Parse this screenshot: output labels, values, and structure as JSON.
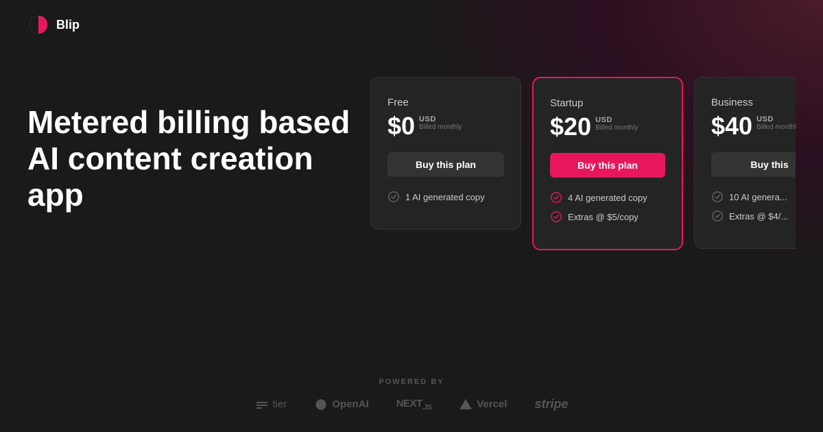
{
  "brand": {
    "logo_text": "Blip"
  },
  "hero": {
    "title_line1": "Metered billing based",
    "title_line2": "AI content creation app"
  },
  "pricing": {
    "plans": [
      {
        "id": "free",
        "name": "Free",
        "price": "$0",
        "currency": "USD",
        "billing": "Billed monthly",
        "button_label": "Buy this plan",
        "featured": false,
        "features": [
          "1 AI generated copy"
        ]
      },
      {
        "id": "startup",
        "name": "Startup",
        "price": "$20",
        "currency": "USD",
        "billing": "Billed monthly",
        "button_label": "Buy this plan",
        "featured": true,
        "features": [
          "4 AI generated copy",
          "Extras @ $5/copy"
        ]
      },
      {
        "id": "business",
        "name": "Business",
        "price": "$40",
        "currency": "USD",
        "billing": "Billed monthly",
        "button_label": "Buy this",
        "featured": false,
        "features": [
          "10 AI genera...",
          "Extras @ $4/..."
        ]
      }
    ]
  },
  "footer": {
    "powered_by_label": "POWERED BY",
    "partners": [
      "tier",
      "OpenAI",
      "NEXT.js",
      "Vercel",
      "stripe"
    ]
  }
}
